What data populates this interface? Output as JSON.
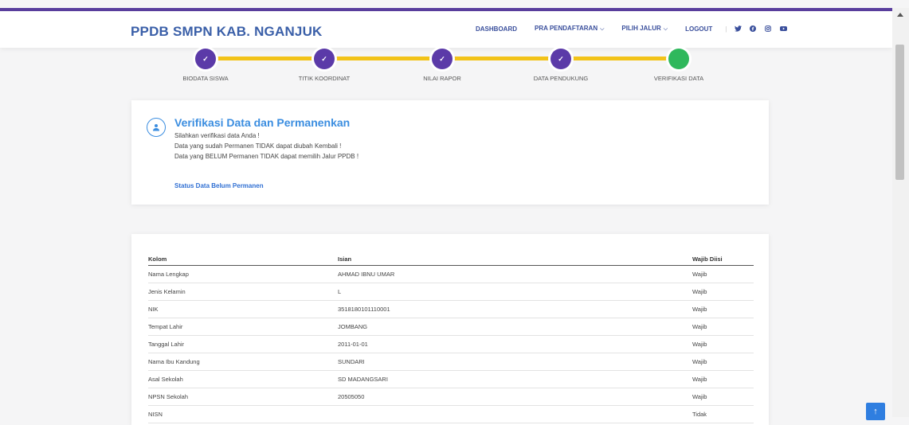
{
  "brand": "PPDB SMPN KAB. NGANJUK",
  "nav": {
    "dashboard": "DASHBOARD",
    "pra_pendaftaran": "PRA PENDAFTARAN",
    "pilih_jalur": "PILIH JALUR",
    "logout": "LOGOUT",
    "separator": "|"
  },
  "steps": [
    {
      "label": "BIODATA SISWA",
      "status": "done"
    },
    {
      "label": "TITIK KOORDINAT",
      "status": "done"
    },
    {
      "label": "NILAI RAPOR",
      "status": "done"
    },
    {
      "label": "DATA PENDUKUNG",
      "status": "done"
    },
    {
      "label": "VERIFIKASI DATA",
      "status": "active"
    }
  ],
  "verifikasi": {
    "title": "Verifikasi Data dan Permanenkan",
    "lines": [
      "Silahkan verifikasi data Anda !",
      "Data yang sudah Permanen TIDAK dapat diubah Kembali !",
      "Data yang BELUM Permanen TIDAK dapat memilih Jalur PPDB !"
    ],
    "status": "Status Data Belum Permanen"
  },
  "table": {
    "headers": [
      "Kolom",
      "Isian",
      "Wajib Diisi"
    ],
    "rows": [
      [
        "Nama Lengkap",
        "AHMAD IBNU UMAR",
        "Wajib"
      ],
      [
        "Jenis Kelamin",
        "L",
        "Wajib"
      ],
      [
        "NIK",
        "3518180101110001",
        "Wajib"
      ],
      [
        "Tempat Lahir",
        "JOMBANG",
        "Wajib"
      ],
      [
        "Tanggal Lahir",
        "2011-01-01",
        "Wajib"
      ],
      [
        "Nama Ibu Kandung",
        "SUNDARI",
        "Wajib"
      ],
      [
        "Asal Sekolah",
        "SD MADANGSARI",
        "Wajib"
      ],
      [
        "NPSN Sekolah",
        "20505050",
        "Wajib"
      ],
      [
        "NISN",
        "",
        "Tidak"
      ]
    ]
  },
  "colors": {
    "brand": "#3a5fa8",
    "step_done": "#5b3aa8",
    "step_active": "#2fb85c",
    "step_line": "#f2c319",
    "accent": "#3a8de0",
    "link": "#2f6fd3"
  },
  "icons": {
    "twitter": "twitter-icon",
    "facebook": "facebook-icon",
    "instagram": "instagram-icon",
    "youtube": "youtube-icon",
    "user": "user-icon",
    "check": "check-icon",
    "scroll_top": "arrow-up-icon"
  }
}
